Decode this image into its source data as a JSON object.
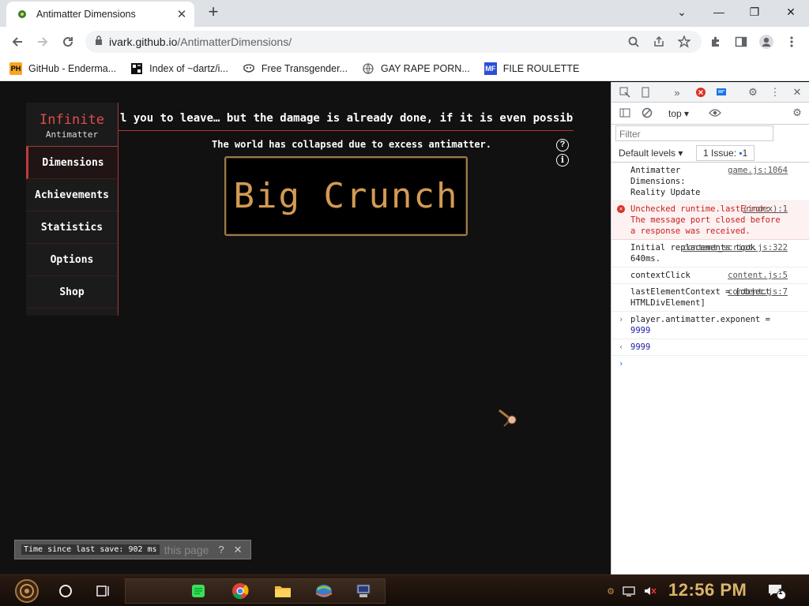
{
  "browser": {
    "tab_title": "Antimatter Dimensions",
    "url_host": "ivark.github.io",
    "url_path": "/AntimatterDimensions/",
    "bookmarks": [
      {
        "label": "GitHub - Enderma...",
        "icon": "PH"
      },
      {
        "label": "Index of ~dartz/i...",
        "icon": "grid"
      },
      {
        "label": "Free Transgender...",
        "icon": "mask"
      },
      {
        "label": "GAY RAPE PORN...",
        "icon": "globe"
      },
      {
        "label": "FILE ROULETTE",
        "icon": "MF"
      }
    ]
  },
  "game": {
    "news_ticker": "l you to leave… but the damage is already done, if it is even possible t",
    "logo_line1": "Infinite",
    "logo_line2": "Antimatter",
    "sidebar": [
      "Dimensions",
      "Achievements",
      "Statistics",
      "Options",
      "Shop"
    ],
    "collapse_message": "The world has collapsed due to excess antimatter.",
    "big_crunch_label": "Big Crunch",
    "help_glyph": "?",
    "info_glyph": "i",
    "save_text": "Time since last save: 902 ms",
    "save_ghost": "this page",
    "save_help": "?",
    "save_close": "✕"
  },
  "devtools": {
    "context": "top",
    "filter_placeholder": "Filter",
    "levels": "Default levels ▾",
    "issues": "1 Issue:",
    "issues_count": "1",
    "console": [
      {
        "text": "Antimatter Dimensions: Reality Update",
        "src": "game.js:1064",
        "kind": "log"
      },
      {
        "text": "Unchecked runtime.lastError: The message port closed before a response was received.",
        "src": "(index):1",
        "kind": "error"
      },
      {
        "text": "Initial replacements took 640ms.",
        "src": "content_script.js:322",
        "kind": "log"
      },
      {
        "text": "contextClick",
        "src": "content.js:5",
        "kind": "log"
      },
      {
        "text": "lastElementContext = [object HTMLDivElement]",
        "src": "content.js:7",
        "kind": "log"
      },
      {
        "text": "player.antimatter.exponent =",
        "value": "9999",
        "kind": "input"
      },
      {
        "text": "9999",
        "kind": "result"
      }
    ]
  },
  "taskbar": {
    "clock": "12:56 PM",
    "notification_count": "1"
  },
  "colors": {
    "accent_red": "#c13a3a",
    "crunch_gold": "#d49a54",
    "game_bg": "#111111"
  }
}
